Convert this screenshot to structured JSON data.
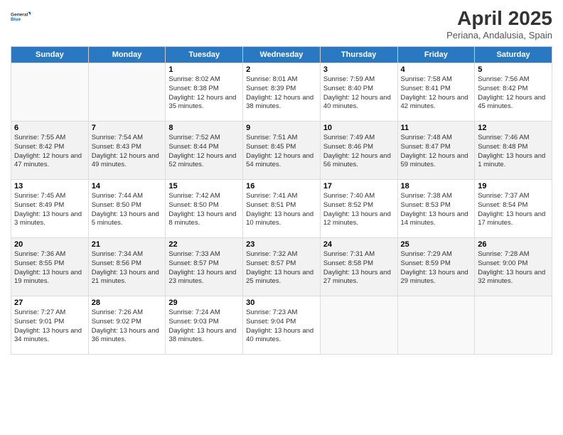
{
  "logo": {
    "line1": "General",
    "line2": "Blue"
  },
  "title": "April 2025",
  "subtitle": "Periana, Andalusia, Spain",
  "headers": [
    "Sunday",
    "Monday",
    "Tuesday",
    "Wednesday",
    "Thursday",
    "Friday",
    "Saturday"
  ],
  "weeks": [
    [
      {
        "day": "",
        "info": ""
      },
      {
        "day": "",
        "info": ""
      },
      {
        "day": "1",
        "info": "Sunrise: 8:02 AM\nSunset: 8:38 PM\nDaylight: 12 hours and 35 minutes."
      },
      {
        "day": "2",
        "info": "Sunrise: 8:01 AM\nSunset: 8:39 PM\nDaylight: 12 hours and 38 minutes."
      },
      {
        "day": "3",
        "info": "Sunrise: 7:59 AM\nSunset: 8:40 PM\nDaylight: 12 hours and 40 minutes."
      },
      {
        "day": "4",
        "info": "Sunrise: 7:58 AM\nSunset: 8:41 PM\nDaylight: 12 hours and 42 minutes."
      },
      {
        "day": "5",
        "info": "Sunrise: 7:56 AM\nSunset: 8:42 PM\nDaylight: 12 hours and 45 minutes."
      }
    ],
    [
      {
        "day": "6",
        "info": "Sunrise: 7:55 AM\nSunset: 8:42 PM\nDaylight: 12 hours and 47 minutes."
      },
      {
        "day": "7",
        "info": "Sunrise: 7:54 AM\nSunset: 8:43 PM\nDaylight: 12 hours and 49 minutes."
      },
      {
        "day": "8",
        "info": "Sunrise: 7:52 AM\nSunset: 8:44 PM\nDaylight: 12 hours and 52 minutes."
      },
      {
        "day": "9",
        "info": "Sunrise: 7:51 AM\nSunset: 8:45 PM\nDaylight: 12 hours and 54 minutes."
      },
      {
        "day": "10",
        "info": "Sunrise: 7:49 AM\nSunset: 8:46 PM\nDaylight: 12 hours and 56 minutes."
      },
      {
        "day": "11",
        "info": "Sunrise: 7:48 AM\nSunset: 8:47 PM\nDaylight: 12 hours and 59 minutes."
      },
      {
        "day": "12",
        "info": "Sunrise: 7:46 AM\nSunset: 8:48 PM\nDaylight: 13 hours and 1 minute."
      }
    ],
    [
      {
        "day": "13",
        "info": "Sunrise: 7:45 AM\nSunset: 8:49 PM\nDaylight: 13 hours and 3 minutes."
      },
      {
        "day": "14",
        "info": "Sunrise: 7:44 AM\nSunset: 8:50 PM\nDaylight: 13 hours and 5 minutes."
      },
      {
        "day": "15",
        "info": "Sunrise: 7:42 AM\nSunset: 8:50 PM\nDaylight: 13 hours and 8 minutes."
      },
      {
        "day": "16",
        "info": "Sunrise: 7:41 AM\nSunset: 8:51 PM\nDaylight: 13 hours and 10 minutes."
      },
      {
        "day": "17",
        "info": "Sunrise: 7:40 AM\nSunset: 8:52 PM\nDaylight: 13 hours and 12 minutes."
      },
      {
        "day": "18",
        "info": "Sunrise: 7:38 AM\nSunset: 8:53 PM\nDaylight: 13 hours and 14 minutes."
      },
      {
        "day": "19",
        "info": "Sunrise: 7:37 AM\nSunset: 8:54 PM\nDaylight: 13 hours and 17 minutes."
      }
    ],
    [
      {
        "day": "20",
        "info": "Sunrise: 7:36 AM\nSunset: 8:55 PM\nDaylight: 13 hours and 19 minutes."
      },
      {
        "day": "21",
        "info": "Sunrise: 7:34 AM\nSunset: 8:56 PM\nDaylight: 13 hours and 21 minutes."
      },
      {
        "day": "22",
        "info": "Sunrise: 7:33 AM\nSunset: 8:57 PM\nDaylight: 13 hours and 23 minutes."
      },
      {
        "day": "23",
        "info": "Sunrise: 7:32 AM\nSunset: 8:57 PM\nDaylight: 13 hours and 25 minutes."
      },
      {
        "day": "24",
        "info": "Sunrise: 7:31 AM\nSunset: 8:58 PM\nDaylight: 13 hours and 27 minutes."
      },
      {
        "day": "25",
        "info": "Sunrise: 7:29 AM\nSunset: 8:59 PM\nDaylight: 13 hours and 29 minutes."
      },
      {
        "day": "26",
        "info": "Sunrise: 7:28 AM\nSunset: 9:00 PM\nDaylight: 13 hours and 32 minutes."
      }
    ],
    [
      {
        "day": "27",
        "info": "Sunrise: 7:27 AM\nSunset: 9:01 PM\nDaylight: 13 hours and 34 minutes."
      },
      {
        "day": "28",
        "info": "Sunrise: 7:26 AM\nSunset: 9:02 PM\nDaylight: 13 hours and 36 minutes."
      },
      {
        "day": "29",
        "info": "Sunrise: 7:24 AM\nSunset: 9:03 PM\nDaylight: 13 hours and 38 minutes."
      },
      {
        "day": "30",
        "info": "Sunrise: 7:23 AM\nSunset: 9:04 PM\nDaylight: 13 hours and 40 minutes."
      },
      {
        "day": "",
        "info": ""
      },
      {
        "day": "",
        "info": ""
      },
      {
        "day": "",
        "info": ""
      }
    ]
  ]
}
